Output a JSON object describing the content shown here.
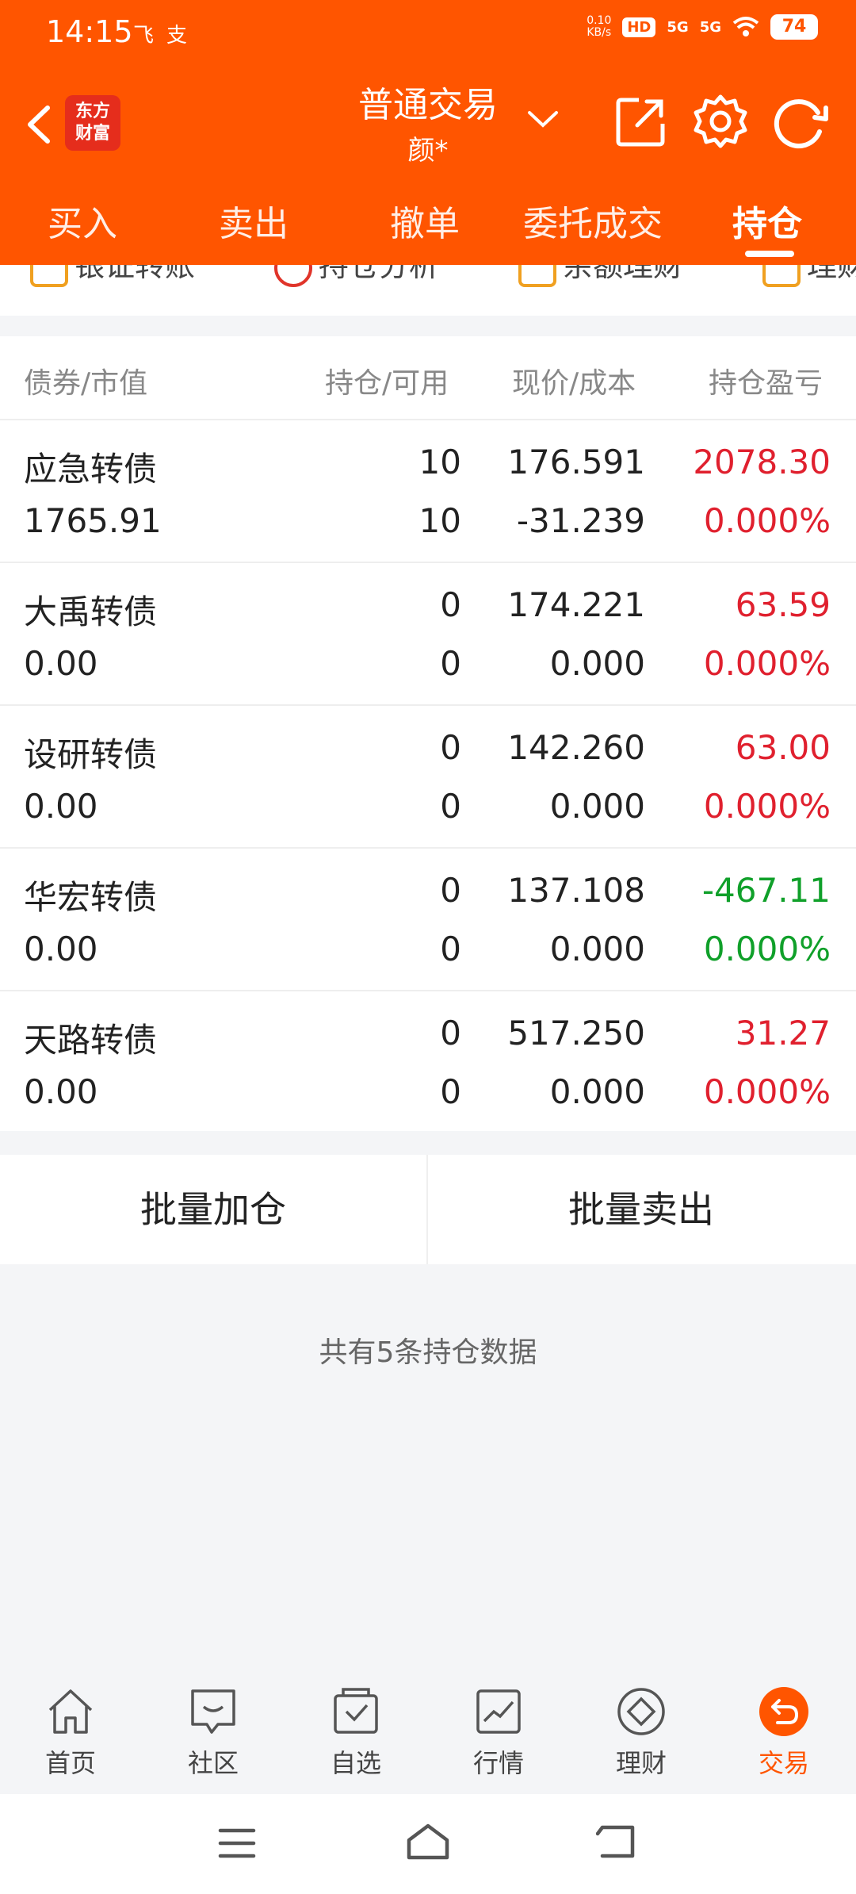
{
  "status_bar": {
    "time": "14:15",
    "app_icons": [
      "飞",
      "支"
    ],
    "net_speed_top": "0.10",
    "net_speed_bottom": "KB/s",
    "hd": "HD",
    "signal1": "5G",
    "signal2": "5G",
    "battery": "74"
  },
  "header": {
    "logo_line1": "东方",
    "logo_line2": "财富",
    "title": "普通交易",
    "subtitle": "颜*"
  },
  "tabs": [
    "买入",
    "卖出",
    "撤单",
    "委托成交",
    "持仓"
  ],
  "active_tab": "持仓",
  "quick_actions": [
    "银证转账",
    "持仓分析",
    "余额理财",
    "理财"
  ],
  "table": {
    "headers": [
      "债券/市值",
      "持仓/可用",
      "现价/成本",
      "持仓盈亏"
    ],
    "rows": [
      {
        "name": "应急转债",
        "market_value": "1765.91",
        "hold": "10",
        "avail": "10",
        "price": "176.591",
        "cost": "-31.239",
        "pnl": "2078.30",
        "pnl_pct": "0.000%",
        "pnl_color": "red"
      },
      {
        "name": "大禹转债",
        "market_value": "0.00",
        "hold": "0",
        "avail": "0",
        "price": "174.221",
        "cost": "0.000",
        "pnl": "63.59",
        "pnl_pct": "0.000%",
        "pnl_color": "red"
      },
      {
        "name": "设研转债",
        "market_value": "0.00",
        "hold": "0",
        "avail": "0",
        "price": "142.260",
        "cost": "0.000",
        "pnl": "63.00",
        "pnl_pct": "0.000%",
        "pnl_color": "red"
      },
      {
        "name": "华宏转债",
        "market_value": "0.00",
        "hold": "0",
        "avail": "0",
        "price": "137.108",
        "cost": "0.000",
        "pnl": "-467.11",
        "pnl_pct": "0.000%",
        "pnl_color": "green"
      },
      {
        "name": "天路转债",
        "market_value": "0.00",
        "hold": "0",
        "avail": "0",
        "price": "517.250",
        "cost": "0.000",
        "pnl": "31.27",
        "pnl_pct": "0.000%",
        "pnl_color": "red"
      }
    ]
  },
  "batch": {
    "add": "批量加仓",
    "sell": "批量卖出"
  },
  "summary": "共有5条持仓数据",
  "bottom_nav": [
    "首页",
    "社区",
    "自选",
    "行情",
    "理财",
    "交易"
  ],
  "colors": {
    "brand": "#ff5500",
    "up": "#e0202e",
    "down": "#10a02a"
  }
}
